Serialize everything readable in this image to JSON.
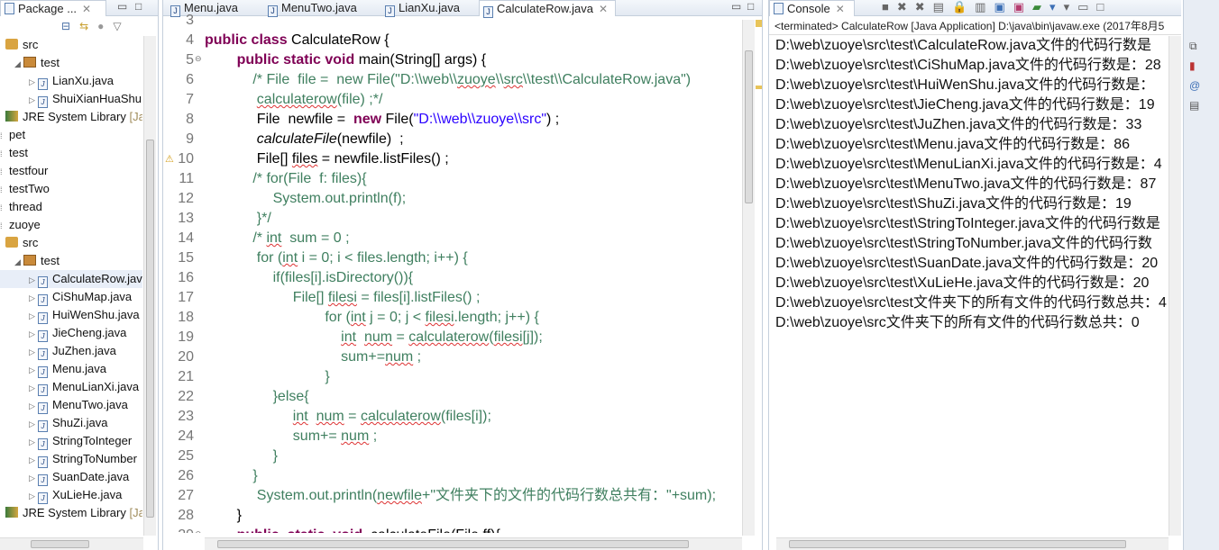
{
  "package_explorer": {
    "title": "Package ...",
    "items": [
      {
        "label": "src",
        "kind": "pkgroot",
        "depth": 0
      },
      {
        "label": "test",
        "kind": "package",
        "depth": 1,
        "open": true
      },
      {
        "label": "LianXu.java",
        "kind": "file",
        "depth": 2
      },
      {
        "label": "ShuiXianHuaShu",
        "kind": "file",
        "depth": 2
      },
      {
        "label": "JRE System Library",
        "suffix": " [Ja",
        "kind": "jre",
        "depth": 0
      },
      {
        "label": "pet",
        "kind": "project",
        "depth": -1
      },
      {
        "label": "test",
        "kind": "project",
        "depth": -1
      },
      {
        "label": "testfour",
        "kind": "project",
        "depth": -1
      },
      {
        "label": "testTwo",
        "kind": "project",
        "depth": -1
      },
      {
        "label": "thread",
        "kind": "project",
        "depth": -1
      },
      {
        "label": "zuoye",
        "kind": "project",
        "depth": -1
      },
      {
        "label": "src",
        "kind": "pkgroot",
        "depth": 0
      },
      {
        "label": "test",
        "kind": "package",
        "depth": 1,
        "open": true
      },
      {
        "label": "CalculateRow.java",
        "kind": "file",
        "depth": 2
      },
      {
        "label": "CiShuMap.java",
        "kind": "file",
        "depth": 2
      },
      {
        "label": "HuiWenShu.java",
        "kind": "file",
        "depth": 2
      },
      {
        "label": "JieCheng.java",
        "kind": "file",
        "depth": 2
      },
      {
        "label": "JuZhen.java",
        "kind": "file",
        "depth": 2
      },
      {
        "label": "Menu.java",
        "kind": "file",
        "depth": 2
      },
      {
        "label": "MenuLianXi.java",
        "kind": "file",
        "depth": 2
      },
      {
        "label": "MenuTwo.java",
        "kind": "file",
        "depth": 2
      },
      {
        "label": "ShuZi.java",
        "kind": "file",
        "depth": 2
      },
      {
        "label": "StringToInteger",
        "kind": "file",
        "depth": 2
      },
      {
        "label": "StringToNumber",
        "kind": "file",
        "depth": 2
      },
      {
        "label": "SuanDate.java",
        "kind": "file",
        "depth": 2
      },
      {
        "label": "XuLieHe.java",
        "kind": "file",
        "depth": 2
      },
      {
        "label": "JRE System Library",
        "suffix": " [Ja",
        "kind": "jre",
        "depth": 0
      }
    ]
  },
  "editor": {
    "tabs": [
      "Menu.java",
      "MenuTwo.java",
      "LianXu.java",
      "CalculateRow.java"
    ],
    "active_tab": 3,
    "lines": [
      {
        "n": "3",
        "segs": []
      },
      {
        "n": "4",
        "segs": [
          {
            "t": "public class ",
            "c": "kw"
          },
          {
            "t": "CalculateRow {",
            "c": ""
          }
        ]
      },
      {
        "n": "5",
        "segs": [
          {
            "t": "        ",
            "c": ""
          },
          {
            "t": "public static void ",
            "c": "kw"
          },
          {
            "t": "main(String[] args) {",
            "c": ""
          }
        ]
      },
      {
        "n": "6",
        "segs": [
          {
            "t": "            /* File  file =  new File(\"D:\\\\web\\\\",
            "c": "cm"
          },
          {
            "t": "zuoye",
            "c": "cm sq"
          },
          {
            "t": "\\\\",
            "c": "cm"
          },
          {
            "t": "src",
            "c": "cm sq"
          },
          {
            "t": "\\\\test\\\\CalculateRow.java\")",
            "c": "cm"
          }
        ]
      },
      {
        "n": "7",
        "segs": [
          {
            "t": "             ",
            "c": ""
          },
          {
            "t": "calculaterow",
            "c": "cm sq"
          },
          {
            "t": "(file) ;*/",
            "c": "cm"
          }
        ]
      },
      {
        "n": "8",
        "segs": [
          {
            "t": "             File  newfile =  ",
            "c": ""
          },
          {
            "t": "new ",
            "c": "kw"
          },
          {
            "t": "File(",
            "c": ""
          },
          {
            "t": "\"D:\\\\web\\\\zuoye\\\\src\"",
            "c": "st"
          },
          {
            "t": ") ;",
            "c": ""
          }
        ]
      },
      {
        "n": "9",
        "segs": [
          {
            "t": "             ",
            "c": ""
          },
          {
            "t": "calculateFile",
            "c": "it"
          },
          {
            "t": "(newfile)  ;",
            "c": ""
          }
        ]
      },
      {
        "n": "10",
        "segs": [
          {
            "t": "             File[] ",
            "c": ""
          },
          {
            "t": "files",
            "c": "sq"
          },
          {
            "t": " = newfile.listFiles() ;",
            "c": ""
          }
        ]
      },
      {
        "n": "11",
        "segs": [
          {
            "t": "            /* for(File  f: files){",
            "c": "cm"
          }
        ]
      },
      {
        "n": "12",
        "segs": [
          {
            "t": "                 System.out.println(f);",
            "c": "cm"
          }
        ]
      },
      {
        "n": "13",
        "segs": [
          {
            "t": "             }*/",
            "c": "cm"
          }
        ]
      },
      {
        "n": "14",
        "segs": [
          {
            "t": "            /* ",
            "c": "cm"
          },
          {
            "t": "int",
            "c": "cm sq"
          },
          {
            "t": "  sum = 0 ;",
            "c": "cm"
          }
        ]
      },
      {
        "n": "15",
        "segs": [
          {
            "t": "             for (",
            "c": "cm"
          },
          {
            "t": "int",
            "c": "cm sq"
          },
          {
            "t": " i = 0; i < files.length; i++) {",
            "c": "cm"
          }
        ]
      },
      {
        "n": "16",
        "segs": [
          {
            "t": "                 if(files[i].isDirectory()){",
            "c": "cm"
          }
        ]
      },
      {
        "n": "17",
        "segs": [
          {
            "t": "                      File[] ",
            "c": "cm"
          },
          {
            "t": "filesi",
            "c": "cm sq"
          },
          {
            "t": " = files[i].listFiles() ;",
            "c": "cm"
          }
        ]
      },
      {
        "n": "18",
        "segs": [
          {
            "t": "                              for (",
            "c": "cm"
          },
          {
            "t": "int",
            "c": "cm sq"
          },
          {
            "t": " j = 0; j < ",
            "c": "cm"
          },
          {
            "t": "filesi",
            "c": "cm sq"
          },
          {
            "t": ".length; j++) {",
            "c": "cm"
          }
        ]
      },
      {
        "n": "19",
        "segs": [
          {
            "t": "                                  ",
            "c": ""
          },
          {
            "t": "int",
            "c": "cm sq"
          },
          {
            "t": "  ",
            "c": "cm"
          },
          {
            "t": "num",
            "c": "cm sq"
          },
          {
            "t": " = ",
            "c": "cm"
          },
          {
            "t": "calculaterow",
            "c": "cm sq"
          },
          {
            "t": "(",
            "c": "cm"
          },
          {
            "t": "filesi[j]",
            "c": "cm sq"
          },
          {
            "t": ");",
            "c": "cm"
          }
        ]
      },
      {
        "n": "20",
        "segs": [
          {
            "t": "                                  sum+=",
            "c": "cm"
          },
          {
            "t": "num",
            "c": "cm sq"
          },
          {
            "t": " ;",
            "c": "cm"
          }
        ]
      },
      {
        "n": "21",
        "segs": [
          {
            "t": "                              }",
            "c": "cm"
          }
        ]
      },
      {
        "n": "22",
        "segs": [
          {
            "t": "                 }else{",
            "c": "cm"
          }
        ]
      },
      {
        "n": "23",
        "segs": [
          {
            "t": "                      ",
            "c": ""
          },
          {
            "t": "int",
            "c": "cm sq"
          },
          {
            "t": "  ",
            "c": "cm"
          },
          {
            "t": "num",
            "c": "cm sq"
          },
          {
            "t": " = ",
            "c": "cm"
          },
          {
            "t": "calculaterow",
            "c": "cm sq"
          },
          {
            "t": "(files[i]);",
            "c": "cm"
          }
        ]
      },
      {
        "n": "24",
        "segs": [
          {
            "t": "                      sum+= ",
            "c": "cm"
          },
          {
            "t": "num",
            "c": "cm sq"
          },
          {
            "t": " ;",
            "c": "cm"
          }
        ]
      },
      {
        "n": "25",
        "segs": [
          {
            "t": "                 }",
            "c": "cm"
          }
        ]
      },
      {
        "n": "26",
        "segs": [
          {
            "t": "            }",
            "c": "cm"
          }
        ]
      },
      {
        "n": "27",
        "segs": [
          {
            "t": "             System.out.println(",
            "c": "cm"
          },
          {
            "t": "newfile",
            "c": "cm sq"
          },
          {
            "t": "+\"文件夹下的文件的代码行数总共有：\"+sum);",
            "c": "cm"
          }
        ]
      },
      {
        "n": "28",
        "segs": [
          {
            "t": "        }",
            "c": ""
          }
        ]
      },
      {
        "n": "29",
        "segs": [
          {
            "t": "        ",
            "c": ""
          },
          {
            "t": "public  static  void ",
            "c": "kw"
          },
          {
            "t": " calculateFile(File ff){",
            "c": ""
          }
        ]
      }
    ]
  },
  "console": {
    "title": "Console",
    "header": "<terminated> CalculateRow [Java Application] D:\\java\\bin\\javaw.exe (2017年8月5",
    "lines": [
      "D:\\web\\zuoye\\src\\test\\CalculateRow.java文件的代码行数是",
      "D:\\web\\zuoye\\src\\test\\CiShuMap.java文件的代码行数是：28",
      "D:\\web\\zuoye\\src\\test\\HuiWenShu.java文件的代码行数是：",
      "D:\\web\\zuoye\\src\\test\\JieCheng.java文件的代码行数是：19",
      "D:\\web\\zuoye\\src\\test\\JuZhen.java文件的代码行数是：33",
      "D:\\web\\zuoye\\src\\test\\Menu.java文件的代码行数是：86",
      "D:\\web\\zuoye\\src\\test\\MenuLianXi.java文件的代码行数是：4",
      "D:\\web\\zuoye\\src\\test\\MenuTwo.java文件的代码行数是：87",
      "D:\\web\\zuoye\\src\\test\\ShuZi.java文件的代码行数是：19",
      "D:\\web\\zuoye\\src\\test\\StringToInteger.java文件的代码行数是",
      "D:\\web\\zuoye\\src\\test\\StringToNumber.java文件的代码行数",
      "D:\\web\\zuoye\\src\\test\\SuanDate.java文件的代码行数是：20",
      "D:\\web\\zuoye\\src\\test\\XuLieHe.java文件的代码行数是：20",
      "D:\\web\\zuoye\\src\\test文件夹下的所有文件的代码行数总共：4",
      "D:\\web\\zuoye\\src文件夹下的所有文件的代码行数总共：0"
    ]
  }
}
